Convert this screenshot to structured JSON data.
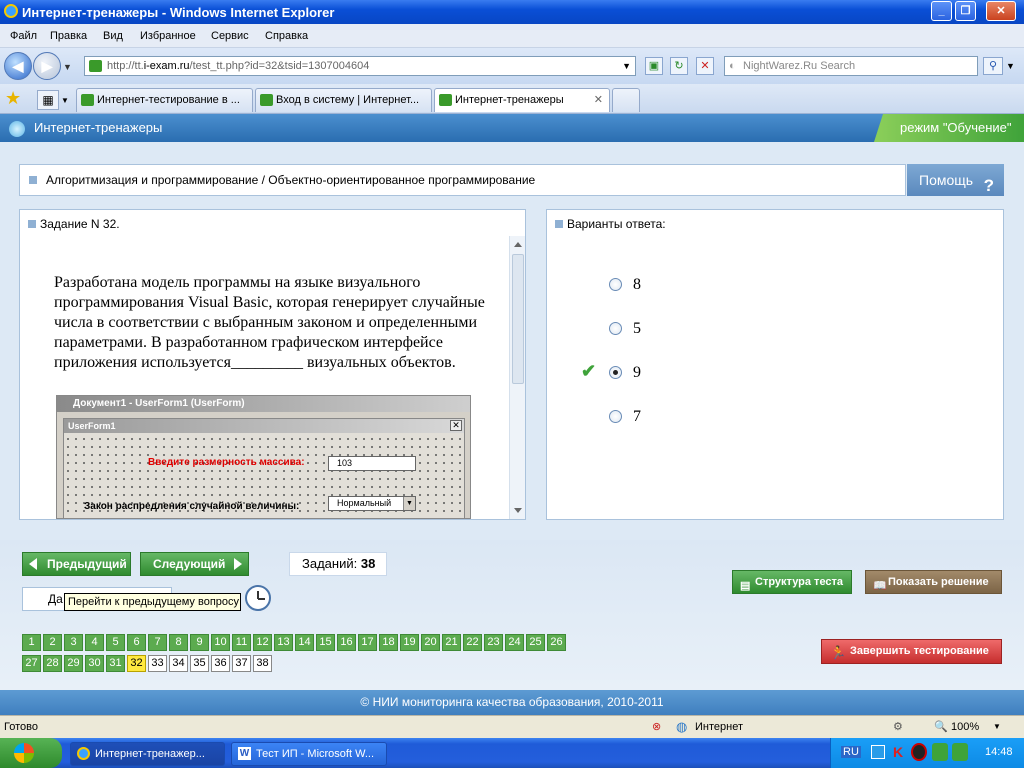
{
  "window": {
    "title": "Интернет-тренажеры - Windows Internet Explorer"
  },
  "menu": [
    "Файл",
    "Правка",
    "Вид",
    "Избранное",
    "Сервис",
    "Справка"
  ],
  "address": {
    "url_prefix": "http://tt.",
    "url_host": "i-exam.ru",
    "url_path": "/test_tt.php?id=32&tsid=1307004604",
    "search_placeholder": "NightWarez.Ru Search"
  },
  "tabs": [
    {
      "label": "Интернет-тестирование в ..."
    },
    {
      "label": "Вход в систему | Интернет..."
    },
    {
      "label": "Интернет-тренажеры"
    }
  ],
  "page": {
    "app_title": "Интернет-тренажеры",
    "mode": "режим \"Обучение\"",
    "breadcrumb": "Алгоритмизация и программирование / Объектно-ориентированное программирование",
    "help": "Помощь",
    "help_mark": "?",
    "task_heading": "Задание N 32.",
    "answers_heading": "Варианты ответа:",
    "question_text": "Разработана модель программы на языке визуального программирования Visual Basic, которая генерирует случайные числа в соответствии с выбранным законом и определенными параметрами. В разработанном графическом интерфейсе приложения используется_________ визуальных объектов.",
    "vb": {
      "doc_caption": "Документ1 - UserForm1 (UserForm)",
      "form_caption": "UserForm1",
      "close_mark": "✕",
      "label1": "Введите размерность массива:",
      "value1": "103",
      "label2": "Закон распредления случайной величины:",
      "value2": "Нормальный"
    },
    "answers": [
      {
        "label": "8",
        "selected": false,
        "correct": false
      },
      {
        "label": "5",
        "selected": false,
        "correct": false
      },
      {
        "label": "9",
        "selected": true,
        "correct": true
      },
      {
        "label": "7",
        "selected": false,
        "correct": false
      }
    ],
    "nav": {
      "prev": "Предыдущий",
      "next": "Следующий",
      "count_label": "Заданий:",
      "count_value": "38",
      "date_visible": "Да",
      "tooltip": "Перейти к предыдущему вопросу",
      "structure": "Структура теста",
      "show_solution": "Показать решение",
      "finish": "Завершить тестирование"
    },
    "question_numbers": {
      "answered_upto": 31,
      "current": 32,
      "total": 38
    },
    "footer": "© НИИ мониторинга качества образования, 2010-2011"
  },
  "statusbar": {
    "left": "Готово",
    "zone": "Интернет",
    "zoom": "100%"
  },
  "taskbar": {
    "tasks": [
      "Интернет-тренажер...",
      "Тест ИП - Microsoft W..."
    ],
    "lang": "RU",
    "time": "14:48"
  }
}
